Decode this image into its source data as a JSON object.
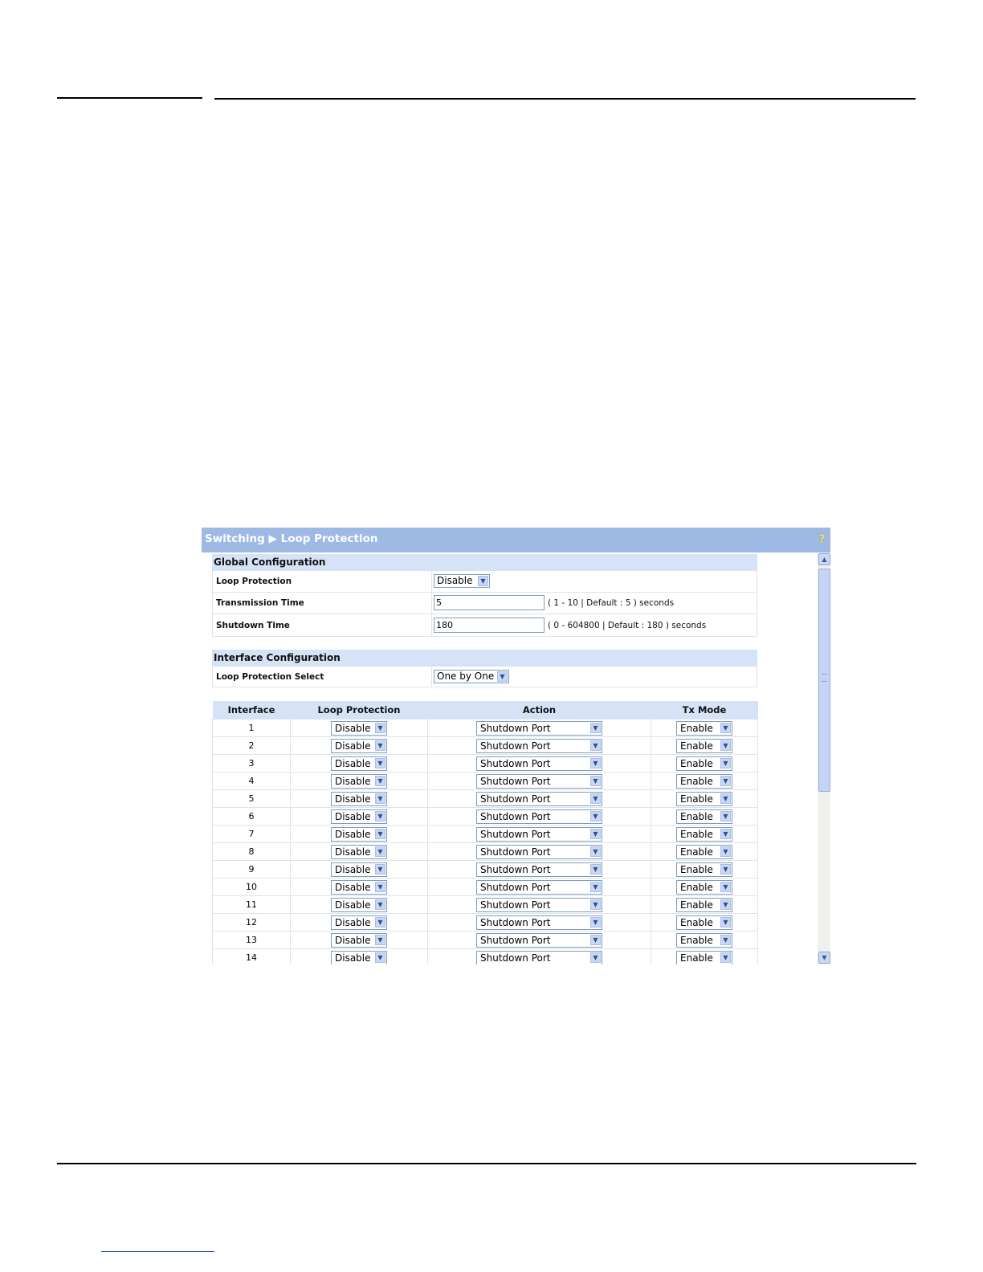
{
  "window": {
    "breadcrumb_section": "Switching",
    "breadcrumb_separator": "▶",
    "breadcrumb_page": "Loop Protection",
    "help_icon": "help-icon"
  },
  "global_config": {
    "heading": "Global Configuration",
    "loop_protection": {
      "label": "Loop Protection",
      "value": "Disable"
    },
    "transmission_time": {
      "label": "Transmission Time",
      "value": "5",
      "hint": "( 1 - 10 | Default : 5 ) seconds"
    },
    "shutdown_time": {
      "label": "Shutdown Time",
      "value": "180",
      "hint": "( 0 - 604800 | Default : 180 ) seconds"
    }
  },
  "interface_config": {
    "heading": "Interface Configuration",
    "select": {
      "label": "Loop Protection Select",
      "value": "One by One"
    }
  },
  "table": {
    "headers": [
      "Interface",
      "Loop Protection",
      "Action",
      "Tx Mode"
    ],
    "rows": [
      {
        "interface": "1",
        "loop_protection": "Disable",
        "action": "Shutdown Port",
        "tx_mode": "Enable"
      },
      {
        "interface": "2",
        "loop_protection": "Disable",
        "action": "Shutdown Port",
        "tx_mode": "Enable"
      },
      {
        "interface": "3",
        "loop_protection": "Disable",
        "action": "Shutdown Port",
        "tx_mode": "Enable"
      },
      {
        "interface": "4",
        "loop_protection": "Disable",
        "action": "Shutdown Port",
        "tx_mode": "Enable"
      },
      {
        "interface": "5",
        "loop_protection": "Disable",
        "action": "Shutdown Port",
        "tx_mode": "Enable"
      },
      {
        "interface": "6",
        "loop_protection": "Disable",
        "action": "Shutdown Port",
        "tx_mode": "Enable"
      },
      {
        "interface": "7",
        "loop_protection": "Disable",
        "action": "Shutdown Port",
        "tx_mode": "Enable"
      },
      {
        "interface": "8",
        "loop_protection": "Disable",
        "action": "Shutdown Port",
        "tx_mode": "Enable"
      },
      {
        "interface": "9",
        "loop_protection": "Disable",
        "action": "Shutdown Port",
        "tx_mode": "Enable"
      },
      {
        "interface": "10",
        "loop_protection": "Disable",
        "action": "Shutdown Port",
        "tx_mode": "Enable"
      },
      {
        "interface": "11",
        "loop_protection": "Disable",
        "action": "Shutdown Port",
        "tx_mode": "Enable"
      },
      {
        "interface": "12",
        "loop_protection": "Disable",
        "action": "Shutdown Port",
        "tx_mode": "Enable"
      },
      {
        "interface": "13",
        "loop_protection": "Disable",
        "action": "Shutdown Port",
        "tx_mode": "Enable"
      },
      {
        "interface": "14",
        "loop_protection": "Disable",
        "action": "Shutdown Port",
        "tx_mode": "Enable"
      }
    ]
  },
  "colors": {
    "title_bar": "#9db9e4",
    "section_header": "#d6e3f6",
    "scrollbar_thumb": "#c3d4f5"
  }
}
